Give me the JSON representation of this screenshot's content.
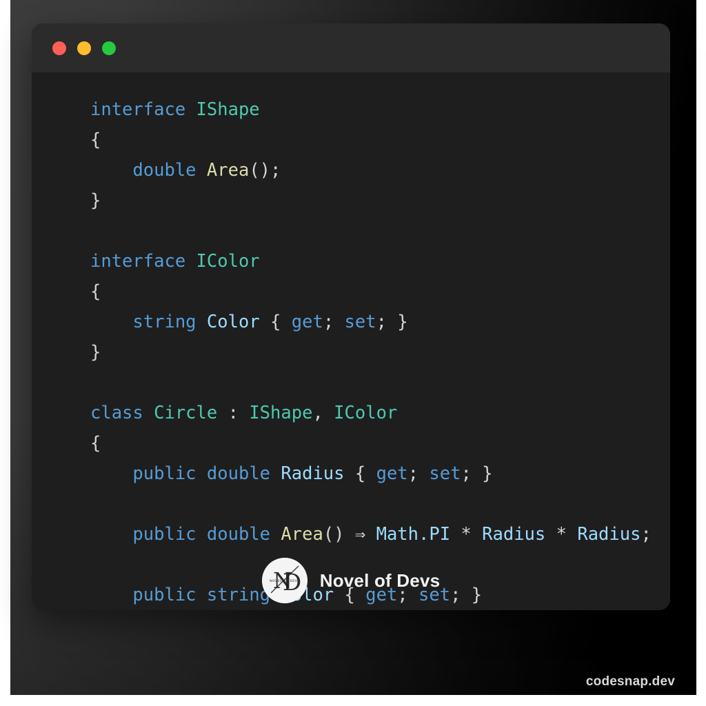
{
  "window": {
    "titlebar": {
      "dots": [
        {
          "name": "close",
          "color": "#ff5f56"
        },
        {
          "name": "minimize",
          "color": "#ffbd2e"
        },
        {
          "name": "maximize",
          "color": "#27c93f"
        }
      ]
    }
  },
  "code": {
    "language": "csharp",
    "lines": [
      "interface IShape",
      "{",
      "    double Area();",
      "}",
      "",
      "interface IColor",
      "{",
      "    string Color { get; set; }",
      "}",
      "",
      "class Circle : IShape, IColor",
      "{",
      "    public double Radius { get; set; }",
      "",
      "    public double Area() ⇒ Math.PI * Radius * Radius;",
      "",
      "    public string Color { get; set; }",
      "}"
    ],
    "tokens": {
      "keyword_color": "#569cd6",
      "type_color": "#4ec9b0",
      "function_color": "#dcdcaa",
      "variable_color": "#9cdcfe",
      "punctuation_color": "#d4d4d4"
    }
  },
  "brand": {
    "name": "Novel of Devs",
    "logo_monogram": "ND",
    "logo_inner_text": "NOVEL OF DEVS"
  },
  "watermark": {
    "text": "codesnap.dev"
  },
  "theme": {
    "window_background": "#1e1e1e",
    "titlebar_background": "#2b2b2b",
    "backdrop_start": "#3c3c3c",
    "backdrop_end": "#000000"
  }
}
